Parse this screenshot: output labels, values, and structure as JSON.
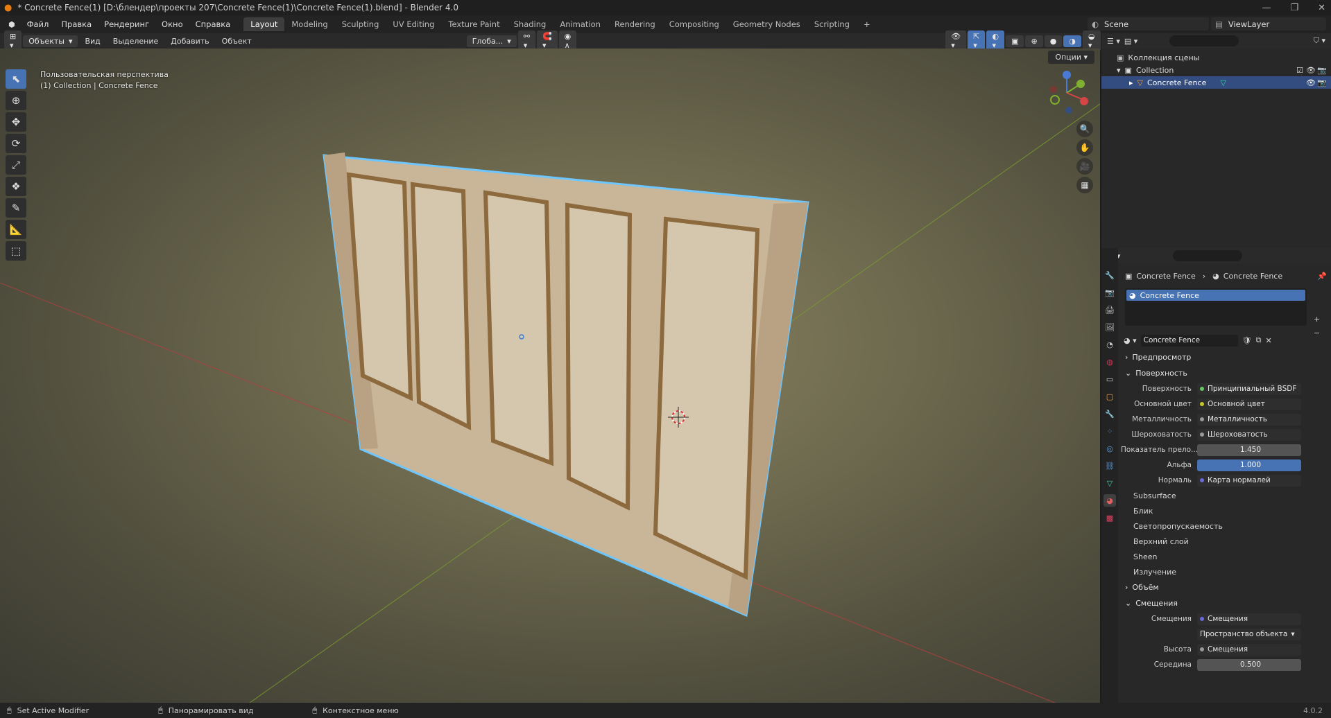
{
  "window": {
    "title": "* Concrete Fence(1) [D:\\блендер\\проекты 207\\Concrete Fence(1)\\Concrete Fence(1).blend] - Blender 4.0",
    "minimize": "—",
    "maximize": "❐",
    "close": "✕"
  },
  "menu": {
    "items": [
      "Файл",
      "Правка",
      "Рендеринг",
      "Окно",
      "Справка"
    ],
    "workspaces": [
      "Layout",
      "Modeling",
      "Sculpting",
      "UV Editing",
      "Texture Paint",
      "Shading",
      "Animation",
      "Rendering",
      "Compositing",
      "Geometry Nodes",
      "Scripting"
    ],
    "add_tab": "+",
    "scene": "Scene",
    "view_layer": "ViewLayer"
  },
  "viewport_header": {
    "mode": "Объекты",
    "view": "Вид",
    "select": "Выделение",
    "add": "Добавить",
    "object": "Объект",
    "orientation": "Глоба...",
    "options": "Опции"
  },
  "viewport": {
    "line1": "Пользовательская перспектива",
    "line2": "(1) Collection | Concrete Fence",
    "axes": {
      "x": "X",
      "y": "Y",
      "z": "Z"
    }
  },
  "outliner": {
    "scene_collection": "Коллекция сцены",
    "collection": "Collection",
    "object": "Concrete Fence"
  },
  "properties": {
    "breadcrumb_object": "Concrete Fence",
    "breadcrumb_material": "Concrete Fence",
    "material_slot": "Concrete Fence",
    "material_name": "Concrete Fence",
    "panels": {
      "preview": "Предпросмотр",
      "surface": "Поверхность",
      "volume": "Объём",
      "displacement": "Смещения"
    },
    "surface_rows": [
      {
        "label": "Поверхность",
        "value": "Принципиальный BSDF"
      },
      {
        "label": "Основной цвет",
        "value": "Основной цвет"
      },
      {
        "label": "Металличность",
        "value": "Металличность"
      },
      {
        "label": "Шероховатость",
        "value": "Шероховатость"
      }
    ],
    "ior_label": "Показатель прело...",
    "ior_value": "1.450",
    "alpha_label": "Альфа",
    "alpha_value": "1.000",
    "normal_label": "Нормаль",
    "normal_value": "Карта нормалей",
    "subpanels": [
      "Subsurface",
      "Блик",
      "Светопропускаемость",
      "Верхний слой",
      "Sheen",
      "Излучение"
    ],
    "disp_label": "Смещения",
    "disp_value": "Смещения",
    "disp_space": "Пространство объекта",
    "height_label": "Высота",
    "height_value": "Смещения",
    "mid_label": "Середина",
    "mid_value": "0.500"
  },
  "statusbar": {
    "left": "Set Active Modifier",
    "middle": "Панорамировать вид",
    "right": "Контекстное меню",
    "version": "4.0.2"
  }
}
